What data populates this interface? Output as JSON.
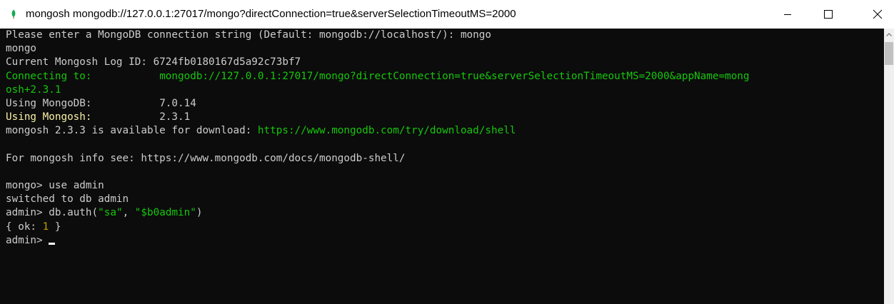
{
  "window": {
    "title": "mongosh mongodb://127.0.0.1:27017/mongo?directConnection=true&serverSelectionTimeoutMS=2000",
    "icon": "leaf-icon",
    "accent_color": "#13aa52"
  },
  "terminal": {
    "line1": "Please enter a MongoDB connection string (Default: mongodb://localhost/): mongo",
    "line2": "mongo",
    "line3": "Current Mongosh Log ID: 6724fb0180167d5a92c73bf7",
    "connecting_label": "Connecting to:",
    "connecting_pad": "           ",
    "connecting_uri_part1": "mongodb://127.0.0.1:27017/mongo?directConnection=true&serverSelectionTimeoutMS=2000&appName=mong",
    "connecting_uri_part2": "osh+2.3.1",
    "using_mongodb_label": "Using MongoDB:",
    "using_mongodb_pad": "           ",
    "using_mongodb_value": "7.0.14",
    "using_mongosh_label": "Using Mongosh:",
    "using_mongosh_pad": "           ",
    "using_mongosh_value": "2.3.1",
    "update_text": "mongosh 2.3.3 is available for download: ",
    "update_url": "https://www.mongodb.com/try/download/shell",
    "info_line": "For mongosh info see: https://www.mongodb.com/docs/mongodb-shell/",
    "prompt_mongo": "mongo> ",
    "cmd_use": "use admin",
    "switched": "switched to db admin",
    "prompt_admin": "admin> ",
    "auth_prefix": "db.auth(",
    "auth_user": "\"sa\"",
    "auth_sep": ", ",
    "auth_pass": "\"$b0admin\"",
    "auth_suffix": ")",
    "ok_prefix": "{ ok: ",
    "ok_value": "1",
    "ok_suffix": " }",
    "final_prompt": "admin> "
  }
}
